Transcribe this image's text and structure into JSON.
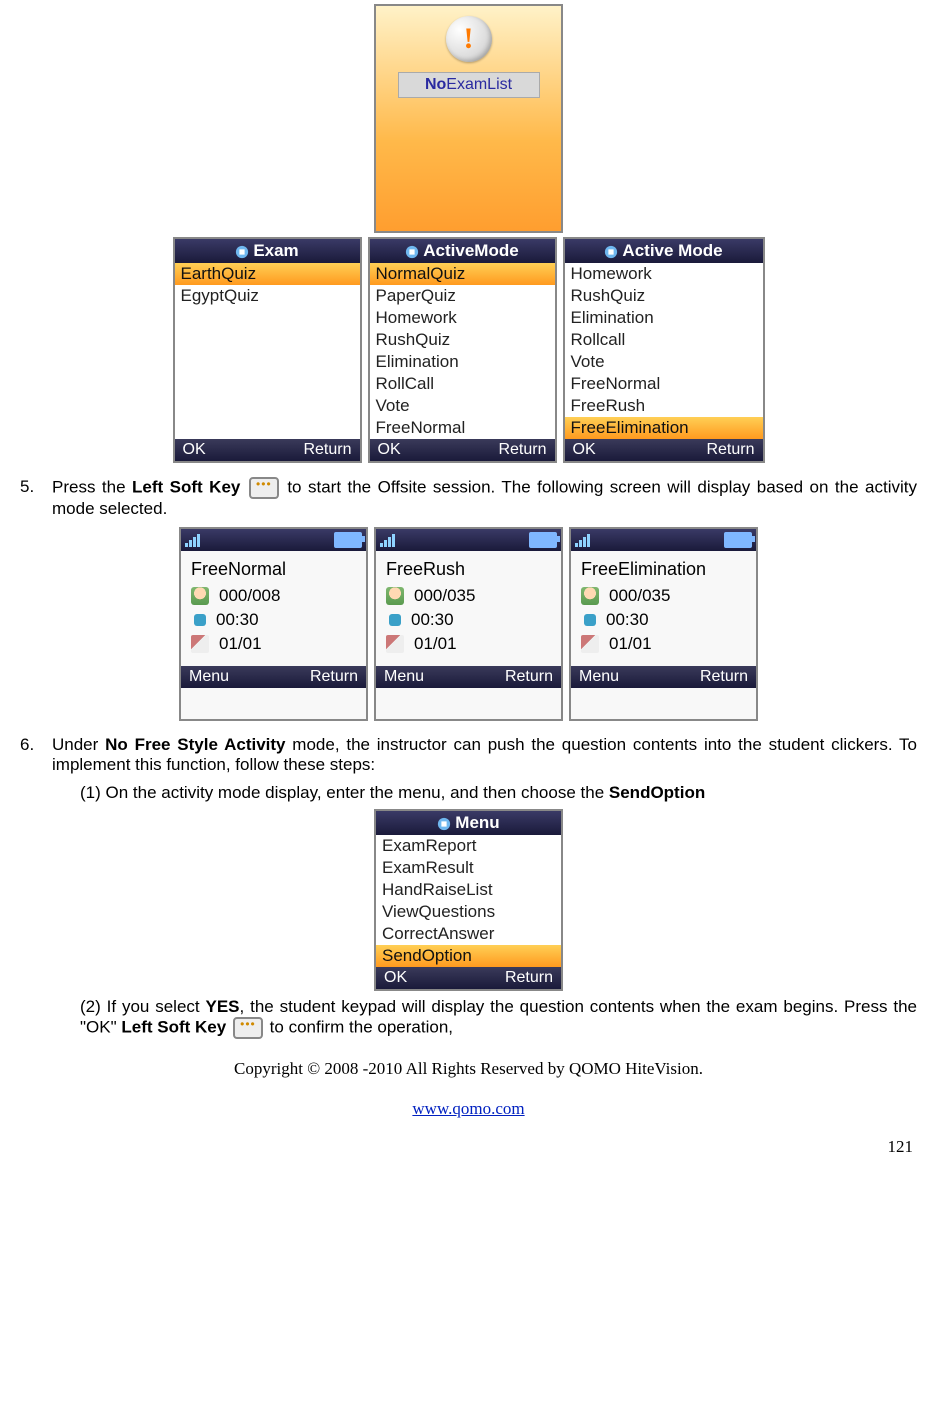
{
  "noexam": {
    "word1": "No",
    "word2": "ExamList"
  },
  "screens_row1": [
    {
      "title": "Exam",
      "items": [
        {
          "label": "EarthQuiz",
          "sel": true
        },
        {
          "label": "EgyptQuiz",
          "sel": false
        }
      ],
      "left": "OK",
      "right": "Return"
    },
    {
      "title": "ActiveMode",
      "items": [
        {
          "label": "NormalQuiz",
          "sel": true
        },
        {
          "label": "PaperQuiz",
          "sel": false
        },
        {
          "label": "Homework",
          "sel": false
        },
        {
          "label": "RushQuiz",
          "sel": false
        },
        {
          "label": "Elimination",
          "sel": false
        },
        {
          "label": "RollCall",
          "sel": false
        },
        {
          "label": "Vote",
          "sel": false
        },
        {
          "label": "FreeNormal",
          "sel": false
        }
      ],
      "left": "OK",
      "right": "Return"
    },
    {
      "title": "Active Mode",
      "items": [
        {
          "label": "Homework",
          "sel": false
        },
        {
          "label": "RushQuiz",
          "sel": false
        },
        {
          "label": "Elimination",
          "sel": false
        },
        {
          "label": "Rollcall",
          "sel": false
        },
        {
          "label": "Vote",
          "sel": false
        },
        {
          "label": "FreeNormal",
          "sel": false
        },
        {
          "label": "FreeRush",
          "sel": false
        },
        {
          "label": "FreeElimination",
          "sel": true
        }
      ],
      "left": "OK",
      "right": "Return"
    }
  ],
  "step5": {
    "num": "5.",
    "pre": "Press the ",
    "key": "Left Soft Key",
    "post": " to start the Offsite session. The following screen will display based on the activity mode selected."
  },
  "sessions": [
    {
      "title": "FreeNormal",
      "count": "000/008",
      "time": "00:30",
      "page": "01/01",
      "left": "Menu",
      "right": "Return"
    },
    {
      "title": "FreeRush",
      "count": "000/035",
      "time": "00:30",
      "page": "01/01",
      "left": "Menu",
      "right": "Return"
    },
    {
      "title": "FreeElimination",
      "count": "000/035",
      "time": "00:30",
      "page": "01/01",
      "left": "Menu",
      "right": "Return"
    }
  ],
  "step6": {
    "num": "6.",
    "pre": "Under ",
    "mode": "No Free Style Activity",
    "post": " mode, the instructor can push the question contents into the student clickers. To implement this function, follow these steps:"
  },
  "sub1": {
    "pre": "(1) On the activity mode display, enter the menu, and then choose the ",
    "bold": "SendOption"
  },
  "menu_screen": {
    "title": "Menu",
    "items": [
      {
        "label": "ExamReport",
        "sel": false
      },
      {
        "label": "ExamResult",
        "sel": false
      },
      {
        "label": "HandRaiseList",
        "sel": false
      },
      {
        "label": "ViewQuestions",
        "sel": false
      },
      {
        "label": "CorrectAnswer",
        "sel": false
      },
      {
        "label": "SendOption",
        "sel": true
      }
    ],
    "left": "OK",
    "right": "Return"
  },
  "sub2": {
    "pre": "(2) If you select ",
    "yes": "YES",
    "mid": ", the student keypad will display the question contents when the exam begins. Press the \"OK\" ",
    "key": "Left Soft Key",
    "post": " to confirm the operation,"
  },
  "copyright": "Copyright © 2008 -2010 All Rights Reserved by QOMO HiteVision.",
  "url": "www.qomo.com",
  "page_number": "121"
}
